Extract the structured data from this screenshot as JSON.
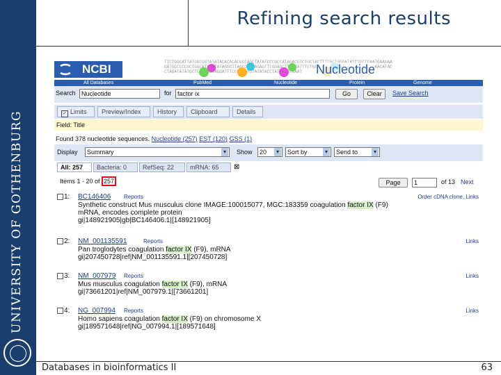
{
  "slide": {
    "title": "Refining search results",
    "footer_left": "Databases in bioinformatics II",
    "page_number": "63",
    "sidebar_text": "UNIVERSITY OF GOTHENBURG",
    "brand_color": "#1a3f6e"
  },
  "ncbi": {
    "logo": "NCBI",
    "db_title": "Nucleotide",
    "dna_text": "TTCTGGCATTATGGCGGTATATACACACACGCCAGCTATATCCCGCCATAGACGTCTGCTACTTTTGCTGGGATATCTGCTCAATGAAGAAGATGCCCCCGCTGGCATATATATAGGCTTAGCCGCAAGAGTTCGGAGCTTAGCATTTCTGACCCGCTTCTATTAATTTCAACCCAACATACCTAGATATATGCTCAAAGCTAGGATTTCCGGCCTGTATATACCTATTAGCCGAAT",
    "nav": [
      "All Databases",
      "PubMed",
      "Nucleotide",
      "Protein",
      "Genome"
    ],
    "search": {
      "label": "Search",
      "db_value": "Nucleotide",
      "for_label": "for",
      "query": "factor ix",
      "go": "Go",
      "clear": "Clear",
      "save": "Save Search"
    },
    "tabs": [
      "Limits",
      "Preview/Index",
      "History",
      "Clipboard",
      "Details"
    ],
    "field_text": "Field: Title",
    "found": {
      "prefix": "Found 378 nucleotide sequences.",
      "nucleotide": "Nucleotide (257)",
      "est": "EST (120)",
      "gss": "GSS (1)"
    },
    "display": {
      "label": "Display",
      "value": "Summary",
      "show_label": "Show",
      "show_value": "20",
      "sort_value": "Sort by",
      "send_value": "Send to"
    },
    "subtabs": [
      "All: 257",
      "Bacteria: 0",
      "RefSeq: 22",
      "mRNA: 65"
    ],
    "items": {
      "prefix": "Items 1 - 20 of",
      "total": "257"
    },
    "pager": {
      "page_btn": "Page",
      "page_value": "1",
      "of": "of 13",
      "next": "Next"
    },
    "results": [
      {
        "num": "1:",
        "acc": "BC146406",
        "reports": "Reports",
        "links": "Order cDNA clone, Links",
        "desc_a": "Synthetic construct Mus musculus clone IMAGE:100015077, MGC:183359 coagulation ",
        "desc_hi": "factor IX",
        "desc_b": " (F9) mRNA, encodes complete protein",
        "gi": "gi|148921905|gb|BC146406.1|[148921905]"
      },
      {
        "num": "2:",
        "acc": "NM_001135591",
        "reports": "Reports",
        "links": "Links",
        "desc_a": "Pan troglodytes coagulation ",
        "desc_hi": "factor IX",
        "desc_b": " (F9), mRNA",
        "gi": "gi|207450728|ref|NM_001135591.1|[207450728]"
      },
      {
        "num": "3:",
        "acc": "NM_007979",
        "reports": "Reports",
        "links": "Links",
        "desc_a": "Mus musculus coagulation ",
        "desc_hi": "factor IX",
        "desc_b": " (F9), mRNA",
        "gi": "gi|73661201|ref|NM_007979.1|[73661201]"
      },
      {
        "num": "4:",
        "acc": "NG_007994",
        "reports": "Reports",
        "links": "Links",
        "desc_a": "Homo sapiens coagulation ",
        "desc_hi": "factor IX",
        "desc_b": " (F9) on chromosome X",
        "gi": "gi|189571648|ref|NG_007994.1|[189571648]"
      }
    ]
  }
}
